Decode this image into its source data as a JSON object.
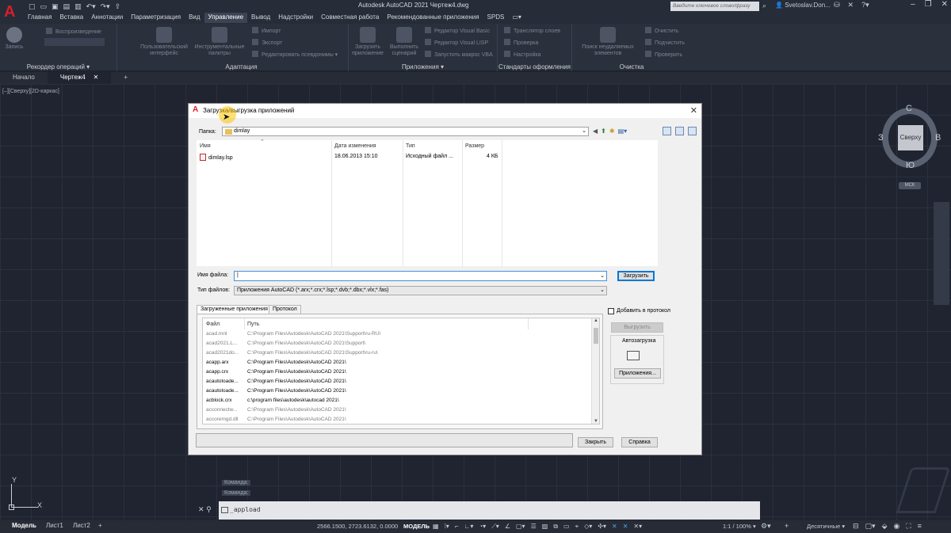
{
  "app": {
    "window_title": "Autodesk AutoCAD 2021   Чертеж4.dwg",
    "search_placeholder": "Введите ключевое слово/фразу",
    "user": "Svetoslav.Don...",
    "menu": [
      "Главная",
      "Вставка",
      "Аннотации",
      "Параметризация",
      "Вид",
      "Управление",
      "Вывод",
      "Надстройки",
      "Совместная работа",
      "Рекомендованные приложения",
      "SPDS"
    ],
    "active_menu": "Управление"
  },
  "ribbon": {
    "panels": [
      {
        "title": "Рекордер операций ▾",
        "big": [
          "Запись"
        ],
        "small": [
          "Воспроизведение"
        ]
      },
      {
        "title": "Адаптация",
        "big": [
          "Пользовательский интерфейс",
          "Инструментальные палитры"
        ],
        "small": [
          "Импорт",
          "Экспорт",
          "Редактировать псевдонимы ▾"
        ]
      },
      {
        "title": "Приложения ▾",
        "big": [
          "Загрузить приложение",
          "Выполнить сценарий"
        ],
        "small": [
          "Редактор Visual Basic",
          "Редактор Visual LISP",
          "Запустить макрос VBA"
        ]
      },
      {
        "title": "Стандарты оформления",
        "small": [
          "Транслятор слоев",
          "Проверка",
          "Настройка"
        ]
      },
      {
        "title": "Очистка",
        "big": [
          "Поиск неудаляемых элементов"
        ],
        "small": [
          "Очистить",
          "Подчистить",
          "Проверить"
        ]
      }
    ]
  },
  "doc_tabs": [
    {
      "label": "Начало",
      "active": false
    },
    {
      "label": "Чертеж4",
      "active": true
    }
  ],
  "viewport_label": "[–][Сверху][2D-каркас]",
  "viewcube": {
    "top": "Сверху",
    "n": "С",
    "s": "Ю",
    "w": "З",
    "e": "В",
    "wcs": "МСК"
  },
  "ucs": {
    "y": "Y",
    "x": "X"
  },
  "command": {
    "history": [
      "Команда:",
      "Команда:"
    ],
    "prompt": "_appload"
  },
  "statusbar": {
    "layout_tabs": [
      "Модель",
      "Лист1",
      "Лист2"
    ],
    "coords": "2566.1500, 2723.6132, 0.0000",
    "mode": "МОДЕЛЬ",
    "scale": "1:1 / 100% ▾",
    "units": "Десятичные ▾"
  },
  "dialog": {
    "title": "Загрузка/выгрузка приложений",
    "folder_label": "Папка:",
    "folder_value": "dimlay",
    "columns": [
      "Имя",
      "Дата изменения",
      "Тип",
      "Размер"
    ],
    "files": [
      {
        "name": "dimlay.lsp",
        "date": "18.06.2013 15:10",
        "type": "Исходный файл ...",
        "size": "4 КБ"
      }
    ],
    "filename_label": "Имя файла:",
    "filename_value": "",
    "filetype_label": "Тип файлов:",
    "filetype_value": "Приложения AutoCAD (*.arx;*.crx;*.lsp;*.dvb;*.dbx;*.vlx;*.fas)",
    "load_button": "Загрузить",
    "tabs": [
      "Загруженные приложения",
      "Протокол"
    ],
    "add_to_history": "Добавить в протокол",
    "loaded_columns": [
      "Файл",
      "Путь"
    ],
    "loaded": [
      {
        "file": "acad.mnl",
        "path": "C:\\Program Files\\Autodesk\\AutoCAD 2021\\Support\\ru-RU\\",
        "grey": true
      },
      {
        "file": "acad2021.L...",
        "path": "C:\\Program Files\\Autodesk\\AutoCAD 2021\\Support\\",
        "grey": true
      },
      {
        "file": "acad2021do...",
        "path": "C:\\Program Files\\Autodesk\\AutoCAD 2021\\Support\\ru-ru\\",
        "grey": true
      },
      {
        "file": "acapp.arx",
        "path": "C:\\Program Files\\Autodesk\\AutoCAD 2021\\",
        "grey": false
      },
      {
        "file": "acapp.crx",
        "path": "C:\\Program Files\\Autodesk\\AutoCAD 2021\\",
        "grey": false
      },
      {
        "file": "acautoloade...",
        "path": "C:\\Program Files\\Autodesk\\AutoCAD 2021\\",
        "grey": false
      },
      {
        "file": "acautoloade...",
        "path": "C:\\Program Files\\Autodesk\\AutoCAD 2021\\",
        "grey": false
      },
      {
        "file": "acblock.crx",
        "path": "c:\\program files\\autodesk\\autocad 2021\\",
        "grey": false
      },
      {
        "file": "acconnectw...",
        "path": "C:\\Program Files\\Autodesk\\AutoCAD 2021\\",
        "grey": true
      },
      {
        "file": "accoremgd.dll",
        "path": "C:\\Program Files\\Autodesk\\AutoCAD 2021\\",
        "grey": true
      }
    ],
    "unload_button": "Выгрузить",
    "autoload_label": "Автозагрузка",
    "apps_button": "Приложения...",
    "close_button": "Закрыть",
    "help_button": "Справка"
  }
}
